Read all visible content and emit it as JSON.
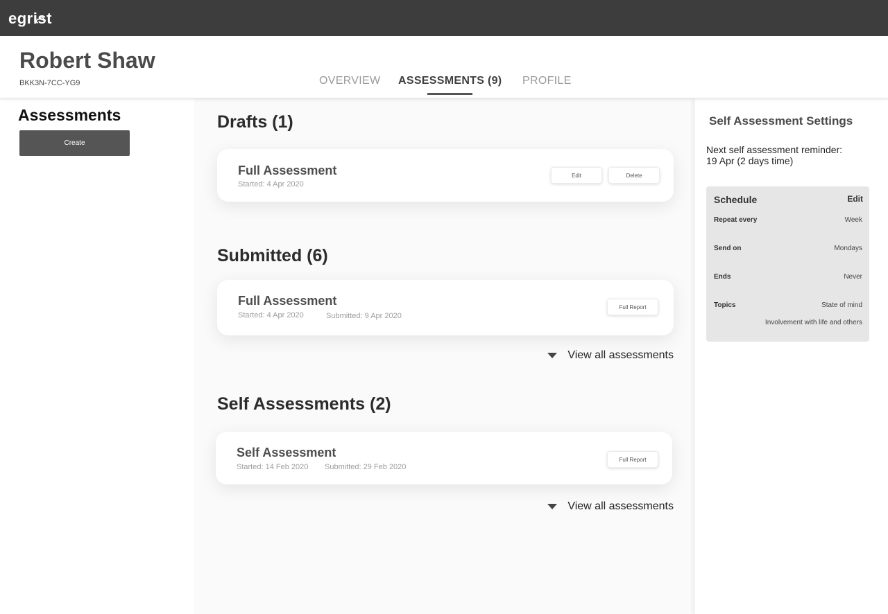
{
  "app": {
    "logo_text": "egrist"
  },
  "header": {
    "user_name": "Robert Shaw",
    "user_id": "BKK3N-7CC-YG9",
    "tabs": [
      {
        "label": "OVERVIEW",
        "active": false
      },
      {
        "label": "ASSESSMENTS (9)",
        "active": true
      },
      {
        "label": "PROFILE",
        "active": false
      }
    ]
  },
  "left": {
    "title": "Assessments",
    "create_label": "Create"
  },
  "main": {
    "drafts": {
      "title": "Drafts (1)",
      "items": [
        {
          "name": "Full Assessment",
          "started": "Started: 4 Apr 2020",
          "edit_label": "Edit",
          "delete_label": "Delete"
        }
      ]
    },
    "submitted": {
      "title": "Submitted (6)",
      "items": [
        {
          "name": "Full Assessment",
          "started": "Started: 4 Apr 2020",
          "submitted": "Submitted: 9 Apr 2020",
          "report_label": "Full Report"
        }
      ],
      "view_all_label": "View all assessments"
    },
    "self": {
      "title": "Self Assessments (2)",
      "items": [
        {
          "name": "Self Assessment",
          "started": "Started: 14 Feb 2020",
          "submitted": "Submitted: 29 Feb 2020",
          "report_label": "Full Report"
        }
      ],
      "view_all_label": "View all assessments"
    }
  },
  "settings": {
    "title": "Self Assessment Settings",
    "reminder_label": "Next self assessment reminder:",
    "reminder_value": "19 Apr (2 days time)",
    "schedule": {
      "title": "Schedule",
      "edit_label": "Edit",
      "rows": [
        {
          "label": "Repeat every",
          "value": "Week"
        },
        {
          "label": "Send on",
          "value": "Mondays"
        },
        {
          "label": "Ends",
          "value": "Never"
        },
        {
          "label": "Topics",
          "value": "State of mind",
          "value2": "Involvement with life and others"
        }
      ]
    }
  },
  "colors": {
    "topbar": "#3d3d3d",
    "primary_button": "#555555",
    "schedule_bg": "#e6e6e6"
  }
}
